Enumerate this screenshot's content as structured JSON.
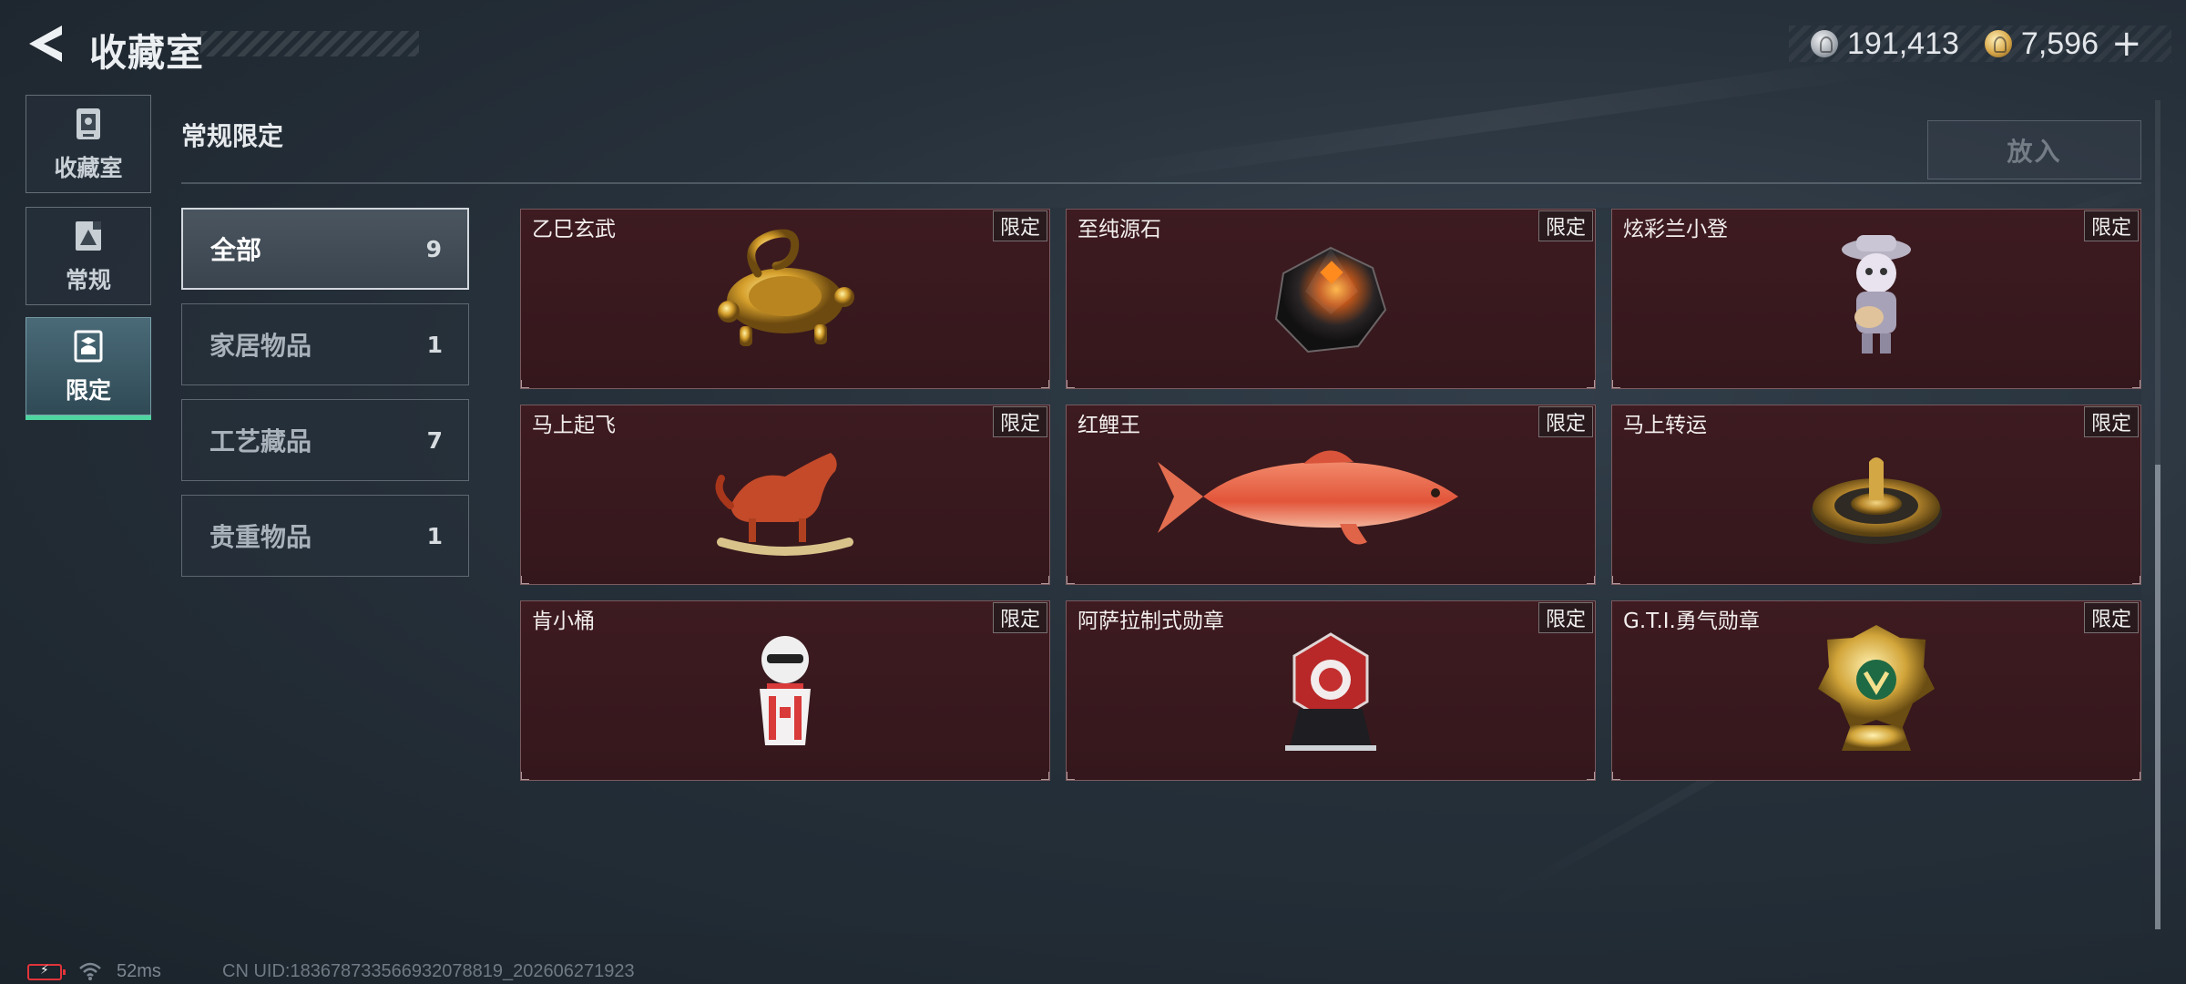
{
  "header": {
    "title": "收藏室",
    "currency": [
      {
        "icon": "silver-coin-icon",
        "value": "191,413"
      },
      {
        "icon": "gold-coin-icon",
        "value": "7,596"
      }
    ],
    "add_label": "+"
  },
  "rail": {
    "items": [
      {
        "label": "收藏室",
        "icon": "trophy-cabinet-icon",
        "active": false
      },
      {
        "label": "常规",
        "icon": "standard-frame-icon",
        "active": false
      },
      {
        "label": "限定",
        "icon": "limited-frame-icon",
        "active": true
      }
    ]
  },
  "section": {
    "title": "常规限定",
    "place_label": "放入"
  },
  "categories": [
    {
      "label": "全部",
      "count": "9",
      "active": true
    },
    {
      "label": "家居物品",
      "count": "1",
      "active": false
    },
    {
      "label": "工艺藏品",
      "count": "7",
      "active": false
    },
    {
      "label": "贵重物品",
      "count": "1",
      "active": false
    }
  ],
  "items": [
    {
      "name": "乙巳玄武",
      "tag": "限定",
      "icon": "golden-serpent-turtle-icon"
    },
    {
      "name": "至纯源石",
      "tag": "限定",
      "icon": "dark-crystal-icon"
    },
    {
      "name": "炫彩兰小登",
      "tag": "限定",
      "icon": "guitar-figure-icon"
    },
    {
      "name": "马上起飞",
      "tag": "限定",
      "icon": "rocking-horse-icon"
    },
    {
      "name": "红鲤王",
      "tag": "限定",
      "icon": "red-carp-icon"
    },
    {
      "name": "马上转运",
      "tag": "限定",
      "icon": "golden-roulette-icon"
    },
    {
      "name": "肯小桶",
      "tag": "限定",
      "icon": "colonel-bucket-icon"
    },
    {
      "name": "阿萨拉制式勋章",
      "tag": "限定",
      "icon": "red-medal-icon"
    },
    {
      "name": "G.T.I.勇气勋章",
      "tag": "限定",
      "icon": "gold-medal-icon"
    }
  ],
  "footer": {
    "ping": "52ms",
    "uid": "CN UID:183678733566932078819_202606271923"
  },
  "colors": {
    "accent_green": "#4fd5a0",
    "card_bg": "#3d1b20",
    "battery_red": "#e0343a"
  }
}
